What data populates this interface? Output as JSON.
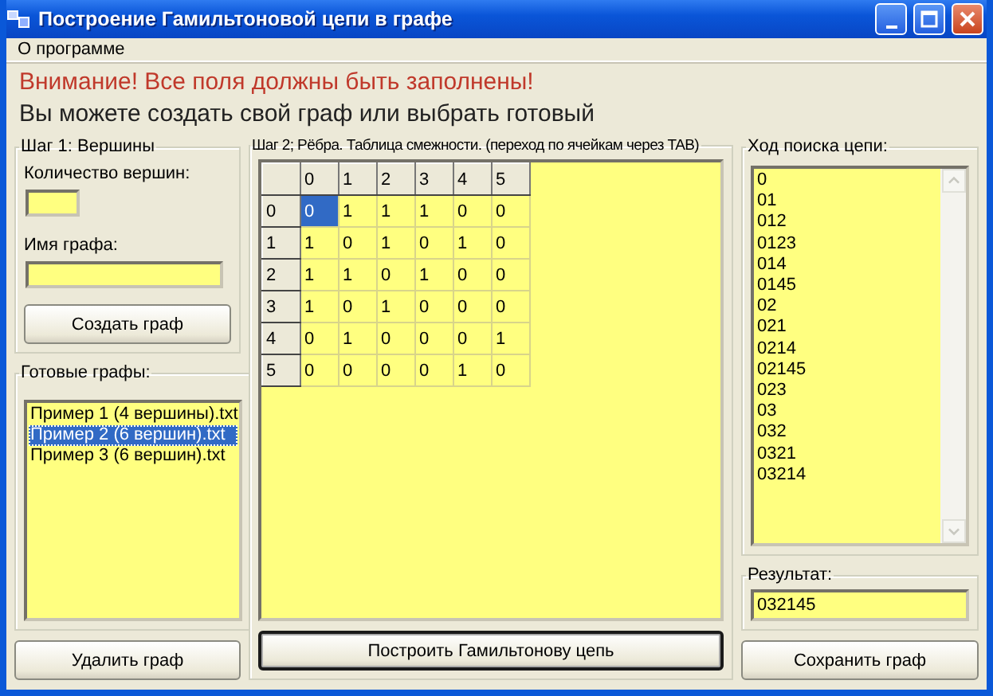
{
  "window": {
    "title": "Построение Гамильтоновой цепи в графе"
  },
  "menu": [
    {
      "label": "О программе"
    }
  ],
  "warning": "Внимание! Все поля должны быть заполнены!",
  "hint": "Вы можете создать свой граф или выбрать готовый",
  "step1": {
    "title": "Шаг 1: Вершины",
    "vertex_count_label": "Количество вершин:",
    "graph_name_label": "Имя графа:",
    "create_button": "Создать граф"
  },
  "ready_graphs": {
    "title": "Готовые графы:",
    "items": [
      {
        "label": "Пример 1 (4 вершины).txt",
        "selected": false
      },
      {
        "label": "Пример 2 (6 вершин).txt",
        "selected": true
      },
      {
        "label": "Пример 3 (6 вершин).txt",
        "selected": false
      }
    ],
    "delete_button": "Удалить граф"
  },
  "step2": {
    "title": "Шаг 2; Рёбра. Таблица смежности. (переход по ячейкам через TAB)",
    "columns": [
      "0",
      "1",
      "2",
      "3",
      "4",
      "5"
    ],
    "rows": [
      {
        "header": "0",
        "cells": [
          {
            "value": "0",
            "selected": true
          },
          {
            "value": "1",
            "selected": false
          },
          {
            "value": "1",
            "selected": false
          },
          {
            "value": "1",
            "selected": false
          },
          {
            "value": "0",
            "selected": false
          },
          {
            "value": "0",
            "selected": false
          }
        ]
      },
      {
        "header": "1",
        "cells": [
          {
            "value": "1",
            "selected": false
          },
          {
            "value": "0",
            "selected": false
          },
          {
            "value": "1",
            "selected": false
          },
          {
            "value": "0",
            "selected": false
          },
          {
            "value": "1",
            "selected": false
          },
          {
            "value": "0",
            "selected": false
          }
        ]
      },
      {
        "header": "2",
        "cells": [
          {
            "value": "1",
            "selected": false
          },
          {
            "value": "1",
            "selected": false
          },
          {
            "value": "0",
            "selected": false
          },
          {
            "value": "1",
            "selected": false
          },
          {
            "value": "0",
            "selected": false
          },
          {
            "value": "0",
            "selected": false
          }
        ]
      },
      {
        "header": "3",
        "cells": [
          {
            "value": "1",
            "selected": false
          },
          {
            "value": "0",
            "selected": false
          },
          {
            "value": "1",
            "selected": false
          },
          {
            "value": "0",
            "selected": false
          },
          {
            "value": "0",
            "selected": false
          },
          {
            "value": "0",
            "selected": false
          }
        ]
      },
      {
        "header": "4",
        "cells": [
          {
            "value": "0",
            "selected": false
          },
          {
            "value": "1",
            "selected": false
          },
          {
            "value": "0",
            "selected": false
          },
          {
            "value": "0",
            "selected": false
          },
          {
            "value": "0",
            "selected": false
          },
          {
            "value": "1",
            "selected": false
          }
        ]
      },
      {
        "header": "5",
        "cells": [
          {
            "value": "0",
            "selected": false
          },
          {
            "value": "0",
            "selected": false
          },
          {
            "value": "0",
            "selected": false
          },
          {
            "value": "0",
            "selected": false
          },
          {
            "value": "1",
            "selected": false
          },
          {
            "value": "0",
            "selected": false
          }
        ]
      }
    ],
    "build_button": {
      "label": "Построить Гамильтонову цепь",
      "default": true
    }
  },
  "search": {
    "title": "Ход поиска цепи:",
    "lines": [
      "0",
      "01",
      "012",
      "0123",
      "014",
      "0145",
      "02",
      "021",
      "0214",
      "02145",
      "023",
      "03",
      "032",
      "0321",
      "03214"
    ]
  },
  "result": {
    "title": "Результат:",
    "value": "032145"
  },
  "save_button": "Сохранить граф"
}
